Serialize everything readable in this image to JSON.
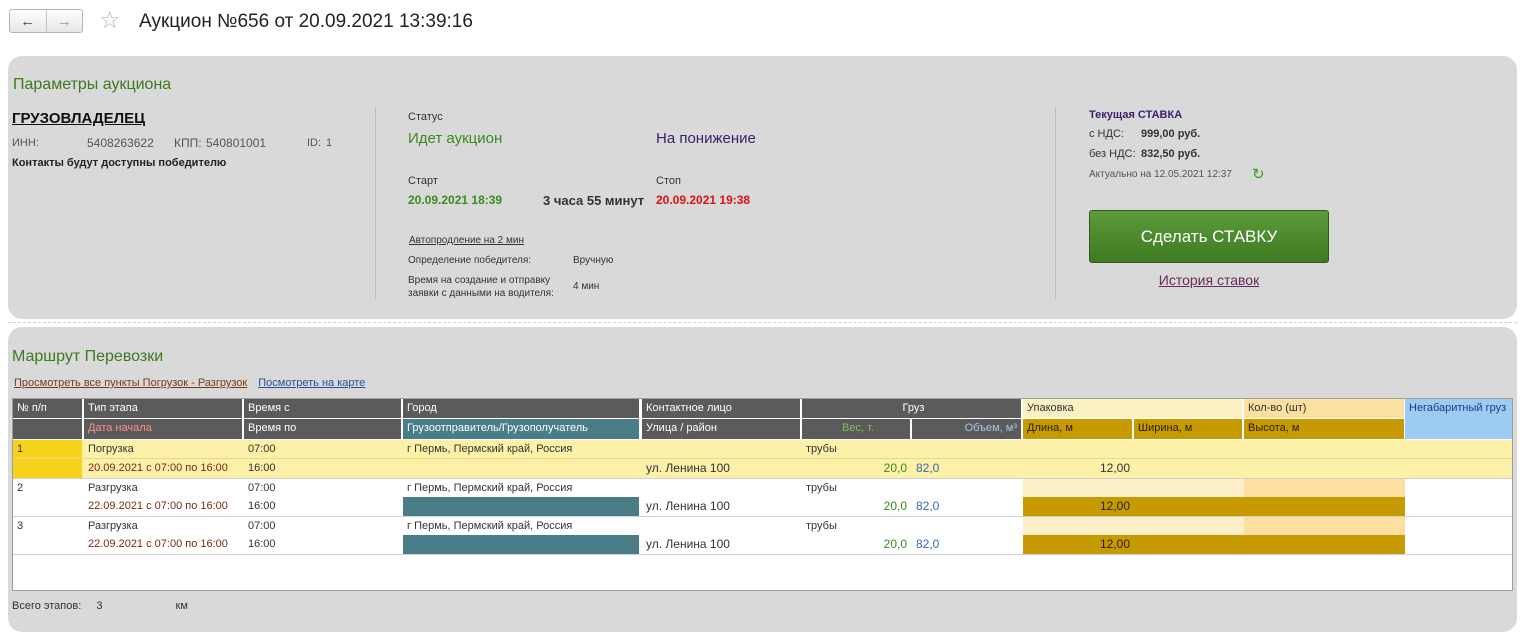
{
  "window": {
    "title": "Аукцион №656 от 20.09.2021 13:39:16",
    "back_glyph": "←",
    "forward_glyph": "→",
    "star_glyph": "☆"
  },
  "params": {
    "section_title": "Параметры аукциона",
    "owner": {
      "heading": "ГРУЗОВЛАДЕЛЕЦ",
      "inn_label": "ИНН:",
      "inn": "5408263622",
      "kpp_label": "КПП:",
      "kpp": "540801001",
      "id_label": "ID:",
      "id": "1",
      "contacts_note": "Контакты будут доступны победителю"
    },
    "status": {
      "label": "Статус",
      "value": "Идет аукцион",
      "direction": "На понижение",
      "start_label": "Старт",
      "start": "20.09.2021 18:39",
      "duration": "3 часа 55 минут",
      "stop_label": "Стоп",
      "stop": "20.09.2021 19:38",
      "auto_extend": "Автопродление на 2 мин",
      "winner_label": "Определение победителя:",
      "winner_value": "Вручную",
      "time_label_1": "Время на создание и отправку",
      "time_label_2": "заявки с данными на водителя:",
      "time_value": "4 мин"
    },
    "bid": {
      "heading": "Текущая СТАВКА",
      "with_vat_label": "с НДС:",
      "with_vat": "999,00 руб.",
      "without_vat_label": "без НДС:",
      "without_vat": "832,50 руб.",
      "actual": "Актуально на 12.05.2021 12:37",
      "refresh_glyph": "↻",
      "make_bid_button": "Сделать СТАВКУ",
      "history_link": "История ставок"
    }
  },
  "route": {
    "section_title": "Маршрут Перевозки",
    "link_all_points": "Просмотреть все пункты Погрузок - Разгрузок",
    "link_map": "Посмотреть на карте",
    "headers": {
      "num": "№ п/п",
      "stage_type": "Тип этапа",
      "start_date": "Дата начала",
      "time_from": "Время с",
      "time_to": "Время по",
      "city": "Город",
      "shipper": "Грузоотправитель/Грузополучатель",
      "contact": "Контактное лицо",
      "street": "Улица / район",
      "cargo": "Груз",
      "weight": "Вес, т.",
      "volume": "Объем, м³",
      "packaging": "Упаковка",
      "length": "Длина, м",
      "width": "Ширина, м",
      "qty": "Кол-во (шт)",
      "height": "Высота, м",
      "oversize": "Негабаритный груз"
    },
    "rows": [
      {
        "num": "1",
        "type": "Погрузка",
        "date": "20.09.2021 с 07:00 по 16:00",
        "time_from": "07:00",
        "time_to": "16:00",
        "city": "г Пермь,  Пермский край, Россия",
        "street": "ул. Ленина 100",
        "cargo": "трубы",
        "weight": "20,0",
        "volume": "82,0",
        "length": "12,00"
      },
      {
        "num": "2",
        "type": "Разгрузка",
        "date": "22.09.2021 с 07:00 по 16:00",
        "time_from": "07:00",
        "time_to": "16:00",
        "city": "г Пермь,  Пермский край, Россия",
        "street": "ул. Ленина 100",
        "cargo": "трубы",
        "weight": "20,0",
        "volume": "82,0",
        "length": "12,00"
      },
      {
        "num": "3",
        "type": "Разгрузка",
        "date": "22.09.2021 с 07:00 по 16:00",
        "time_from": "07:00",
        "time_to": "16:00",
        "city": "г Пермь,  Пермский край, Россия",
        "street": "ул. Ленина 100",
        "cargo": "трубы",
        "weight": "20,0",
        "volume": "82,0",
        "length": "12,00"
      }
    ],
    "footer_label": "Всего этапов:",
    "footer_count": "3",
    "footer_unit": "км"
  },
  "colors": {
    "accent_green": "#3b8a1e",
    "stop_red": "#e01010",
    "selected_row": "#fdf0a8",
    "teal_header": "#4a7d88",
    "gold_header": "#c69a00"
  }
}
